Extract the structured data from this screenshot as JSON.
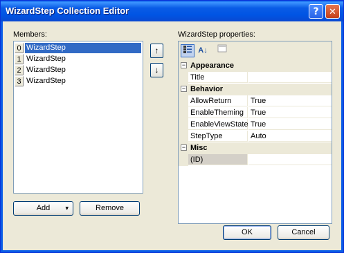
{
  "window": {
    "title": "WizardStep Collection Editor",
    "help_glyph": "?",
    "close_glyph": "✕"
  },
  "members": {
    "label": "Members:",
    "items": [
      {
        "index": "0",
        "label": "WizardStep"
      },
      {
        "index": "1",
        "label": "WizardStep"
      },
      {
        "index": "2",
        "label": "WizardStep"
      },
      {
        "index": "3",
        "label": "WizardStep"
      }
    ],
    "selected_index": 0,
    "move_up_glyph": "↑",
    "move_down_glyph": "↓"
  },
  "buttons": {
    "add": "Add",
    "add_dropdown_glyph": "▾",
    "remove": "Remove",
    "ok": "OK",
    "cancel": "Cancel"
  },
  "properties": {
    "label": "WizardStep properties:",
    "toolbar": {
      "categorized_icon": "categorized-icon",
      "alphabetical_glyph": "A↓",
      "property_pages_icon": "property-pages-icon"
    },
    "categories": [
      {
        "name": "Appearance",
        "rows": [
          {
            "name": "Title",
            "value": ""
          }
        ]
      },
      {
        "name": "Behavior",
        "rows": [
          {
            "name": "AllowReturn",
            "value": "True"
          },
          {
            "name": "EnableTheming",
            "value": "True"
          },
          {
            "name": "EnableViewState",
            "value": "True"
          },
          {
            "name": "StepType",
            "value": "Auto"
          }
        ]
      },
      {
        "name": "Misc",
        "rows": [
          {
            "name": "(ID)",
            "value": ""
          }
        ]
      }
    ],
    "collapse_glyph": "−"
  },
  "colors": {
    "title_bar": "#0a5ce6",
    "selection": "#316ac5",
    "dialog_bg": "#ece9d8"
  }
}
